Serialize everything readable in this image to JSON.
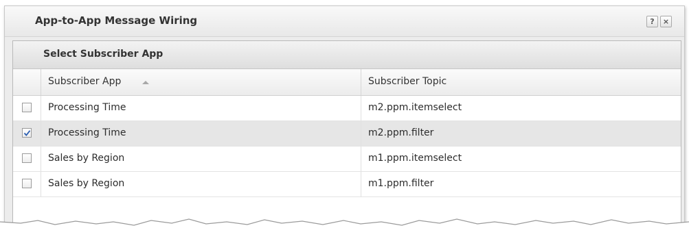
{
  "dialog": {
    "title": "App-to-App Message Wiring",
    "help_label": "?",
    "close_label": "×"
  },
  "panel": {
    "title": "Select Subscriber App"
  },
  "grid": {
    "columns": [
      "Subscriber App",
      "Subscriber Topic"
    ],
    "sort": {
      "column": "Subscriber App",
      "direction": "ascending"
    },
    "rows": [
      {
        "checked": false,
        "app": "Processing Time",
        "topic": "m2.ppm.itemselect"
      },
      {
        "checked": true,
        "app": "Processing Time",
        "topic": "m2.ppm.filter"
      },
      {
        "checked": false,
        "app": "Sales by Region",
        "topic": "m1.ppm.itemselect"
      },
      {
        "checked": false,
        "app": "Sales by Region",
        "topic": "m1.ppm.filter"
      }
    ]
  },
  "colors": {
    "checkmark": "#2a5db0",
    "selected_row": "#e6e6e6"
  }
}
